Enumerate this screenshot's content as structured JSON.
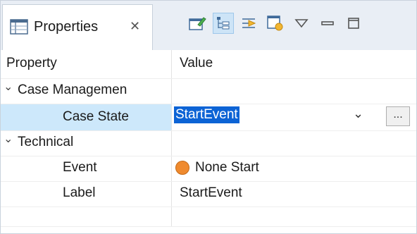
{
  "tab": {
    "title": "Properties",
    "close_glyph": "✕"
  },
  "toolbar": [
    {
      "name": "pin-editor-icon",
      "selected": false
    },
    {
      "name": "show-categories-icon",
      "selected": true
    },
    {
      "name": "show-advanced-icon",
      "selected": false
    },
    {
      "name": "restore-default-icon",
      "selected": false
    },
    {
      "name": "view-menu-icon",
      "selected": false
    },
    {
      "name": "minimize-icon",
      "selected": false
    },
    {
      "name": "maximize-icon",
      "selected": false
    }
  ],
  "table": {
    "headers": {
      "property": "Property",
      "value": "Value"
    },
    "groups": {
      "case_management": {
        "label": "Case Managemen",
        "rows": {
          "case_state": {
            "property": "Case State",
            "value": "StartEvent"
          }
        }
      },
      "technical": {
        "label": "Technical",
        "rows": {
          "event": {
            "property": "Event",
            "value": "None Start"
          },
          "label": {
            "property": "Label",
            "value": "StartEvent"
          }
        }
      }
    }
  },
  "glyphs": {
    "expanded": "⌄",
    "dropdown": "⌄",
    "ellipsis": "..."
  },
  "colors": {
    "selection_row": "#cde8fb",
    "selection_text": "#0c63d5",
    "event_dot": "#ef8a2e"
  }
}
